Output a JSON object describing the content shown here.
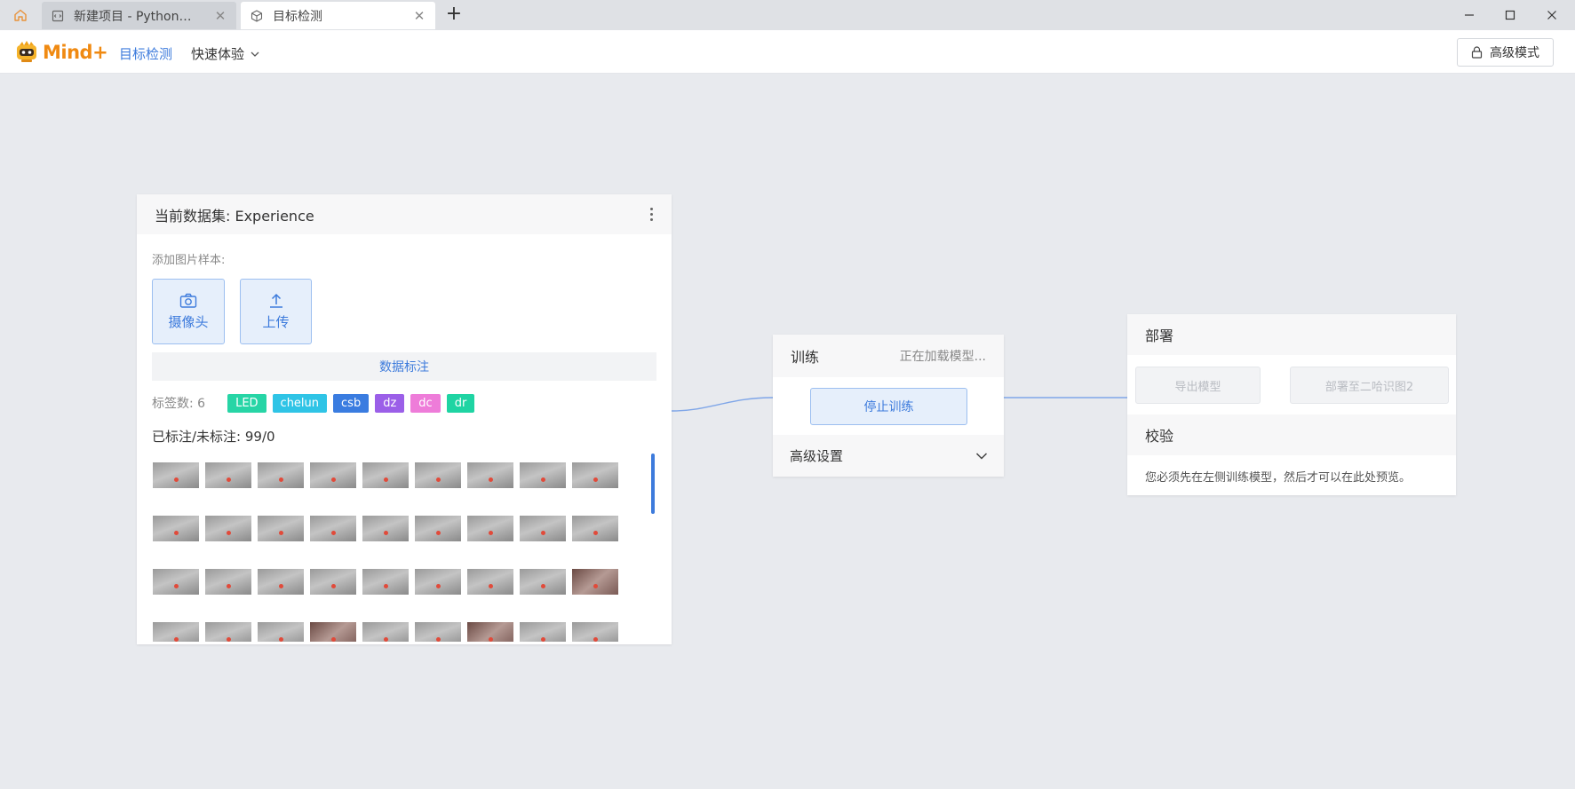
{
  "tabs": [
    {
      "label": "新建项目 - Python…",
      "icon": "code-file-icon"
    },
    {
      "label": "目标检测",
      "icon": "cube-icon"
    }
  ],
  "header": {
    "logo_text": "Mind+",
    "nav_active": "目标检测",
    "nav_quick": "快速体验",
    "advanced_mode": "高级模式"
  },
  "dataset": {
    "title": "当前数据集: Experience",
    "add_samples_label": "添加图片样本:",
    "camera_button": "摄像头",
    "upload_button": "上传",
    "annotate_button": "数据标注",
    "label_count": "标签数: 6",
    "tags": [
      {
        "label": "LED",
        "color": "#27d5a6"
      },
      {
        "label": "chelun",
        "color": "#2fc4e6"
      },
      {
        "label": "csb",
        "color": "#3a7ce0"
      },
      {
        "label": "dz",
        "color": "#9b5fe8"
      },
      {
        "label": "dc",
        "color": "#ee7cd9"
      },
      {
        "label": "dr",
        "color": "#1fd4a3"
      }
    ],
    "annotated_count": "已标注/未标注: 99/0"
  },
  "train": {
    "title": "训练",
    "status": "正在加载模型...",
    "stop_button": "停止训练",
    "advanced_settings": "高级设置"
  },
  "deploy": {
    "title": "部署",
    "export_button": "导出模型",
    "deploy_button": "部署至二哈识图2",
    "verify_title": "校验",
    "verify_text": "您必须先在左侧训练模型，然后才可以在此处预览。"
  },
  "colors": {
    "accent": "#3d7bdc",
    "logo": "#f08a12",
    "background": "#e8eaee"
  }
}
